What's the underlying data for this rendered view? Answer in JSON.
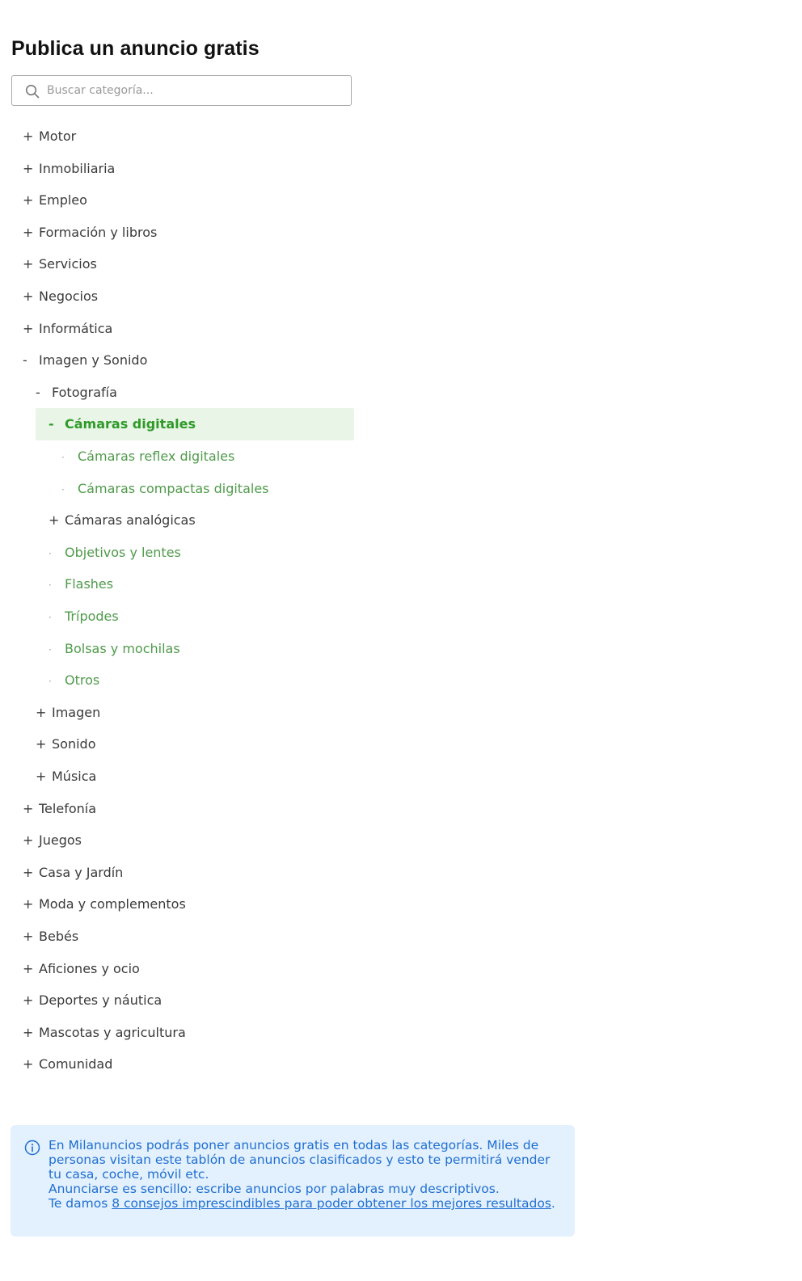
{
  "page": {
    "title": "Publica un anuncio gratis"
  },
  "search": {
    "placeholder": "Buscar categoría...",
    "value": ""
  },
  "tree": [
    {
      "marker": "+",
      "label": "Motor",
      "level": 0,
      "state": "collapsed"
    },
    {
      "marker": "+",
      "label": "Inmobiliaria",
      "level": 0,
      "state": "collapsed"
    },
    {
      "marker": "+",
      "label": "Empleo",
      "level": 0,
      "state": "collapsed"
    },
    {
      "marker": "+",
      "label": "Formación y libros",
      "level": 0,
      "state": "collapsed"
    },
    {
      "marker": "+",
      "label": "Servicios",
      "level": 0,
      "state": "collapsed"
    },
    {
      "marker": "+",
      "label": "Negocios",
      "level": 0,
      "state": "collapsed"
    },
    {
      "marker": "+",
      "label": "Informática",
      "level": 0,
      "state": "collapsed"
    },
    {
      "marker": "-",
      "label": "Imagen y Sonido",
      "level": 0,
      "state": "expanded"
    },
    {
      "marker": "-",
      "label": "Fotografía",
      "level": 1,
      "state": "expanded"
    },
    {
      "marker": "-",
      "label": "Cámaras digitales",
      "level": 2,
      "state": "selected"
    },
    {
      "marker": "·",
      "label": "Cámaras reflex digitales",
      "level": 3,
      "state": "leaf"
    },
    {
      "marker": "·",
      "label": "Cámaras compactas digitales",
      "level": 3,
      "state": "leaf"
    },
    {
      "marker": "+",
      "label": "Cámaras analógicas",
      "level": 2,
      "state": "collapsed"
    },
    {
      "marker": "·",
      "label": "Objetivos y lentes",
      "level": 2,
      "state": "leaf"
    },
    {
      "marker": "·",
      "label": "Flashes",
      "level": 2,
      "state": "leaf"
    },
    {
      "marker": "·",
      "label": "Trípodes",
      "level": 2,
      "state": "leaf"
    },
    {
      "marker": "·",
      "label": "Bolsas y mochilas",
      "level": 2,
      "state": "leaf"
    },
    {
      "marker": "·",
      "label": "Otros",
      "level": 2,
      "state": "leaf"
    },
    {
      "marker": "+",
      "label": "Imagen",
      "level": 1,
      "state": "collapsed"
    },
    {
      "marker": "+",
      "label": "Sonido",
      "level": 1,
      "state": "collapsed"
    },
    {
      "marker": "+",
      "label": "Música",
      "level": 1,
      "state": "collapsed"
    },
    {
      "marker": "+",
      "label": "Telefonía",
      "level": 0,
      "state": "collapsed"
    },
    {
      "marker": "+",
      "label": "Juegos",
      "level": 0,
      "state": "collapsed"
    },
    {
      "marker": "+",
      "label": "Casa y Jardín",
      "level": 0,
      "state": "collapsed"
    },
    {
      "marker": "+",
      "label": "Moda y complementos",
      "level": 0,
      "state": "collapsed"
    },
    {
      "marker": "+",
      "label": "Bebés",
      "level": 0,
      "state": "collapsed"
    },
    {
      "marker": "+",
      "label": "Aficiones y ocio",
      "level": 0,
      "state": "collapsed"
    },
    {
      "marker": "+",
      "label": "Deportes y náutica",
      "level": 0,
      "state": "collapsed"
    },
    {
      "marker": "+",
      "label": "Mascotas y agricultura",
      "level": 0,
      "state": "collapsed"
    },
    {
      "marker": "+",
      "label": "Comunidad",
      "level": 0,
      "state": "collapsed"
    }
  ],
  "info": {
    "icon": "info-icon",
    "paragraph_1": "En Milanuncios podrás poner anuncios gratis en todas las categorías. Miles de personas visitan este tablón de anuncios clasificados y esto te permitirá vender tu casa, coche, móvil etc.",
    "paragraph_2": "Anunciarse es sencillo: escribe anuncios por palabras muy descriptivos.",
    "paragraph_3_prefix": "Te damos ",
    "link_text": "8 consejos imprescindibles para poder obtener los mejores resultados",
    "paragraph_3_suffix": "."
  },
  "colors": {
    "leaf_green": "#4f9a4a",
    "selected_green": "#2f9a29",
    "selected_bg": "#e9f5e7",
    "info_bg": "#e3f0fd",
    "info_text": "#1f6fd1"
  }
}
